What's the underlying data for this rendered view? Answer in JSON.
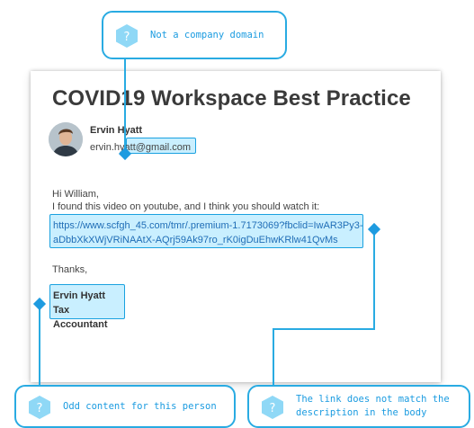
{
  "email": {
    "subject": "COVID19 Workspace Best Practice",
    "sender_name": "Ervin Hyatt",
    "sender_email": "ervin.hyatt@gmail.com",
    "greeting": "Hi William,",
    "intro": "I found this video on youtube, and I  think you should watch it:",
    "link_line1": "https://www.scfgh_45.com/tmr/.premium-1.7173069?fbclid=IwAR3Py3-",
    "link_line2": "aDbbXkXWjVRiNAAtX-AQrj59Ak97ro_rK0igDuEhwKRlw41QvMs",
    "closing": "Thanks,",
    "signature_name": "Ervin Hyatt",
    "signature_title": "Tax Accountant"
  },
  "callouts": {
    "domain": "Not a company domain",
    "signature": "Odd content for this person",
    "link_line1": "The link does not match the",
    "link_line2": "description in the body"
  },
  "colors": {
    "accent": "#29abe2",
    "highlight": "#c9efff",
    "link": "#1f6db6"
  }
}
